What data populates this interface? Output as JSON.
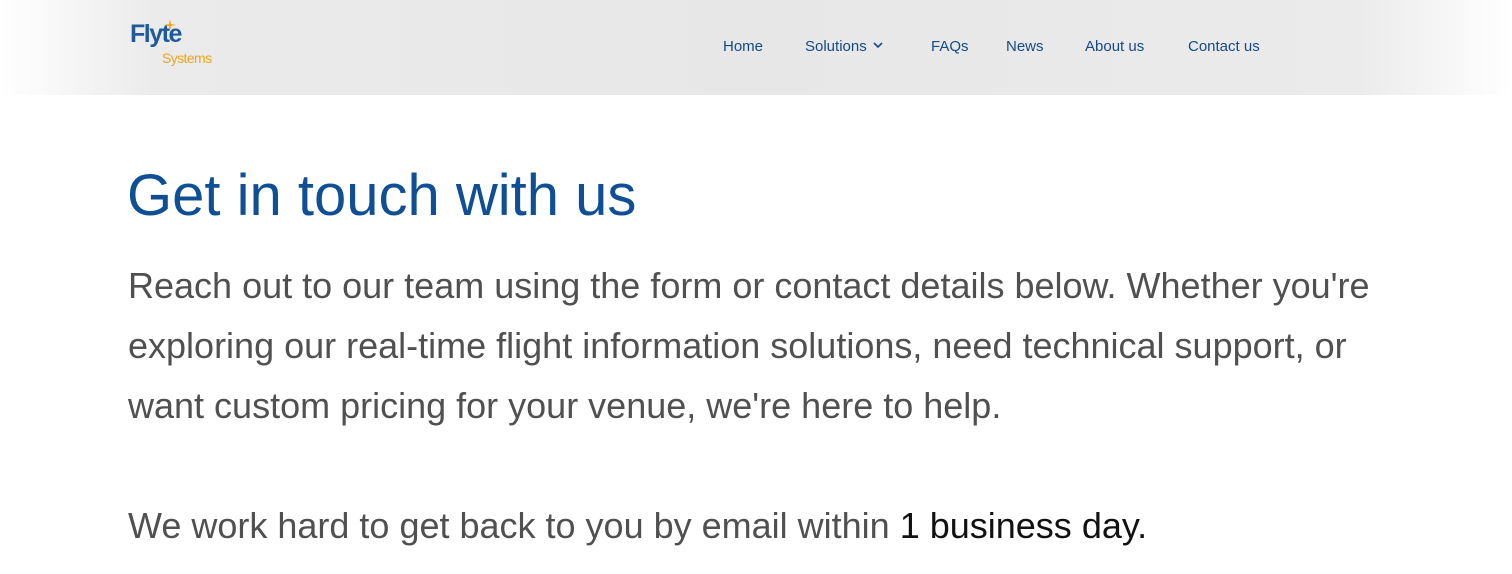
{
  "brand": {
    "logo_main": "Flyte",
    "logo_sub": "Systems",
    "primary_color": "#0f4f95",
    "accent_color": "#f0a51c"
  },
  "nav": {
    "items": [
      {
        "label": "Home"
      },
      {
        "label": "Solutions",
        "has_dropdown": true,
        "icon": "chevron-down-icon"
      },
      {
        "label": "FAQs"
      },
      {
        "label": "News"
      },
      {
        "label": "About us"
      },
      {
        "label": "Contact us"
      }
    ]
  },
  "main": {
    "title": "Get in touch with us",
    "intro": "Reach out to our team using the form or contact details below. Whether you're exploring our real-time flight information solutions, need technical support, or want custom pricing for your venue, we're here to help.",
    "response_prefix": "We work hard to get back to you by email within ",
    "response_highlight": "1 business day."
  }
}
